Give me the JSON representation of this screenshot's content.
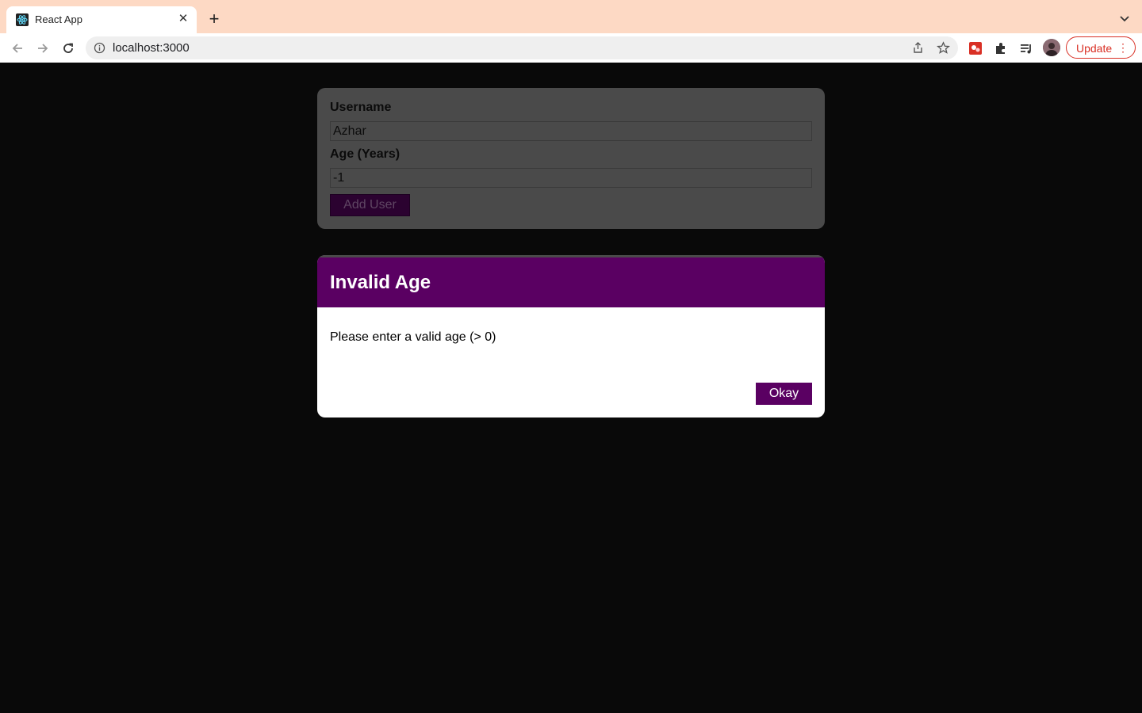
{
  "browser": {
    "tab_title": "React App",
    "url": "localhost:3000",
    "update_label": "Update",
    "icons": [
      "react-favicon",
      "close-icon",
      "plus-icon",
      "chevron-down-icon",
      "back-arrow-icon",
      "forward-arrow-icon",
      "reload-icon",
      "info-icon",
      "share-icon",
      "star-icon",
      "extension-icon",
      "puzzle-icon",
      "reading-list-icon",
      "avatar",
      "more-vert-icon"
    ],
    "colors": {
      "tab_strip": "#fdd9c4",
      "update_accent": "#d93025"
    }
  },
  "form": {
    "username_label": "Username",
    "username_value": "Azhar",
    "age_label": "Age (Years)",
    "age_value": "-1",
    "submit_label": "Add User"
  },
  "modal": {
    "title": "Invalid Age",
    "message": "Please enter a valid age (> 0)",
    "confirm_label": "Okay",
    "accent_color": "#5a0062"
  }
}
